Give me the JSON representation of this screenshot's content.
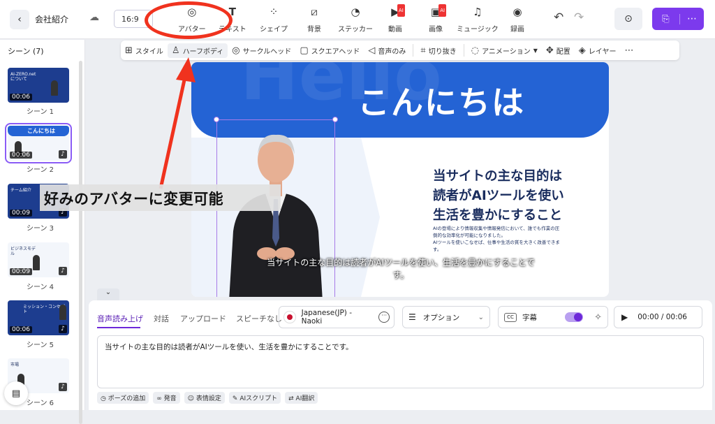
{
  "app": {
    "title": "会社紹介",
    "aspect_ratio": "16:9"
  },
  "toolbar": {
    "items": [
      {
        "label": "アバター",
        "icon": "avatar-icon"
      },
      {
        "label": "テキスト",
        "icon": "text-icon"
      },
      {
        "label": "シェイプ",
        "icon": "shape-icon"
      },
      {
        "label": "背景",
        "icon": "background-icon"
      },
      {
        "label": "ステッカー",
        "icon": "sticker-icon"
      },
      {
        "label": "動画",
        "icon": "video-icon",
        "badge": "AI"
      },
      {
        "label": "画像",
        "icon": "image-icon",
        "badge": "AI"
      },
      {
        "label": "ミュージック",
        "icon": "music-icon"
      },
      {
        "label": "録画",
        "icon": "record-icon"
      }
    ]
  },
  "sidebar": {
    "header": "シーン (7)",
    "scenes": [
      {
        "label": "シーン 1",
        "duration": "00:06",
        "thumb_text": "AI-ZERO.net について"
      },
      {
        "label": "シーン 2",
        "duration": "00:06",
        "thumb_text": "こんにちは"
      },
      {
        "label": "シーン 3",
        "duration": "00:09",
        "thumb_text": "チーム紹介"
      },
      {
        "label": "シーン 4",
        "duration": "00:09",
        "thumb_text": "ビジネスモデル"
      },
      {
        "label": "シーン 5",
        "duration": "00:06",
        "thumb_text": "ミッション・コンセプト"
      },
      {
        "label": "シーン 6",
        "duration": "",
        "thumb_text": "市場"
      }
    ]
  },
  "subtoolbar": {
    "style": "スタイル",
    "half_body": "ハーフボディ",
    "circle_head": "サークルヘッド",
    "square_head": "スクエアヘッド",
    "audio_only": "音声のみ",
    "crop": "切り抜き",
    "animation": "アニメーション",
    "arrange": "配置",
    "layer": "レイヤー"
  },
  "slide": {
    "watermark": "Hello",
    "headline": "こんにちは",
    "title_line1": "当サイトの主な目的は",
    "title_line2": "読者がAIツールを使い",
    "title_line3": "生活を豊かにすること",
    "body_line1": "AIの登場により情報収集や情報発信において、誰でも作業の圧",
    "body_line2": "倒的な効率化が可能になりました。",
    "body_line3": "AIツールを使いこなせば、仕事や生活の質を大きく改善できま",
    "body_line4": "す。",
    "caption_line1": "当サイトの主な目的は読者がAIツールを使い、生活を豊かにすることで",
    "caption_line2": "す。"
  },
  "annotation": {
    "label": "好みのアバターに変更可能",
    "color": "#f0321e"
  },
  "panel": {
    "tabs": [
      "音声読み上げ",
      "対話",
      "アップロード",
      "スピーチなし"
    ],
    "voice": "Japanese(JP) - Naoki",
    "option": "オプション",
    "subtitle": "字幕",
    "time": "00:00 / 00:06",
    "script": "当サイトの主な目的は読者がAIツールを使い、生活を豊かにすることです。",
    "chips": [
      "ポーズの追加",
      "発音",
      "表情設定",
      "AIスクリプト",
      "AI翻訳"
    ]
  },
  "colors": {
    "accent": "#7c3aed",
    "banner": "#2463d4",
    "title": "#1a2d5e"
  }
}
